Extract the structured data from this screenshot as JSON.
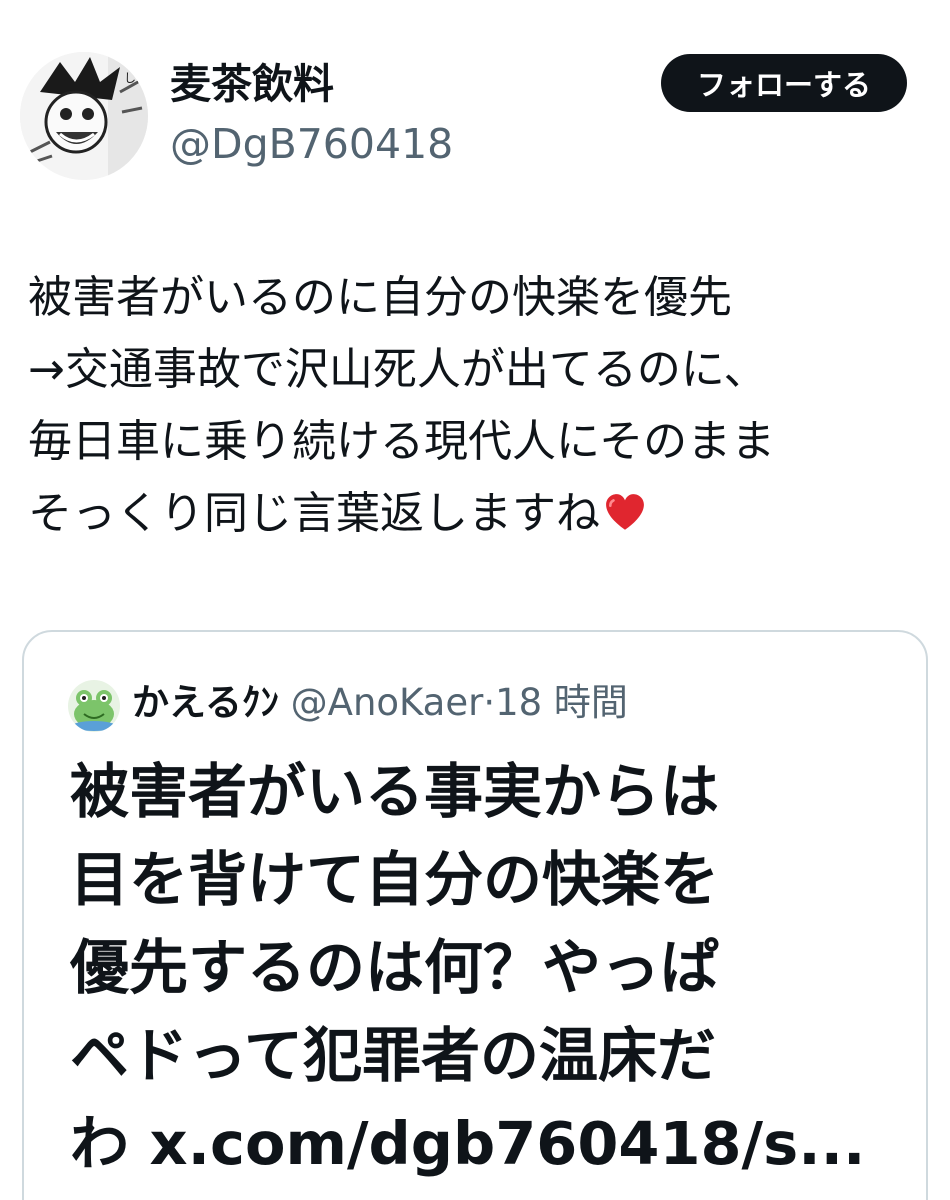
{
  "author": {
    "display_name": "麦茶飲料",
    "handle": "@DgB760418",
    "avatar_icon": "manga-character-avatar"
  },
  "follow_button": {
    "label": "フォローする",
    "bg_color": "#0f1419",
    "text_color": "#ffffff"
  },
  "tweet": {
    "lines": [
      "被害者がいるのに自分の快楽を優先",
      "→交通事故で沢山死人が出てるのに、",
      "毎日車に乗り続ける現代人にそのまま",
      "そっくり同じ言葉返しますね"
    ],
    "trailing_emoji": "red-heart-emoji"
  },
  "quote": {
    "avatar_icon": "frog-avatar",
    "name": "かえるｸﾝ",
    "handle": "@AnoKaer",
    "separator": "·",
    "time": "18 時間",
    "lines": [
      "被害者がいる事実からは",
      "目を背けて自分の快楽を",
      "優先するのは何？やっぱ",
      "ペドって犯罪者の温床だ",
      "わ x.com/dgb760418/s..."
    ]
  },
  "colors": {
    "text_primary": "#0f1419",
    "text_secondary": "#536471",
    "border": "#cfd9de"
  }
}
